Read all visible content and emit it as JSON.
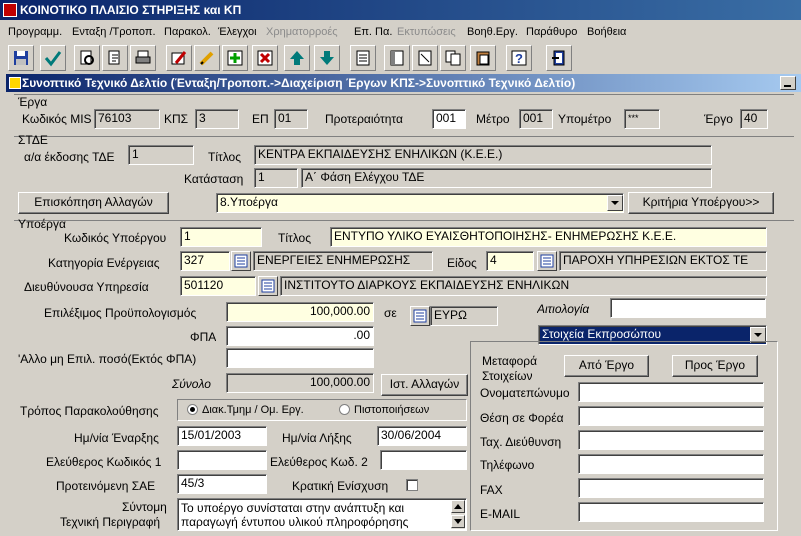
{
  "window": {
    "title": "ΚΟΙΝΟΤΙΚΟ ΠΛΑΙΣΙΟ ΣΤΗΡΙΞΗΣ και ΚΠ"
  },
  "menu": [
    {
      "label": "Προγραμμ."
    },
    {
      "label": "Ενταξη /Τροποπ."
    },
    {
      "label": "Παρακολ."
    },
    {
      "label": "Έλεγχοι"
    },
    {
      "label": "Χρηματορροές",
      "disabled": true
    },
    {
      "label": "Επ. Πα."
    },
    {
      "label": "Εκτυπώσεις",
      "disabled": true
    },
    {
      "label": "Βοηθ.Εργ."
    },
    {
      "label": "Παράθυρο"
    },
    {
      "label": "Βοήθεια"
    }
  ],
  "toolbar_icons": [
    "save-icon",
    "commit-icon",
    "query-icon",
    "execute-query-icon",
    "print-icon",
    "edit-icon",
    "insert-record-icon",
    "delete-record-icon",
    "previous-record-icon",
    "next-record-icon",
    "list-icon",
    "report-icon",
    "document-icon",
    "copy-icon",
    "paste-icon",
    "help-icon",
    "exit-icon"
  ],
  "child_window": {
    "title": "Συνοπτικό Τεχνικό Δελτίο (Ένταξη/Τροποπ.->Διαχείριση Έργων ΚΠΣ->Συνοπτικό Τεχνικό Δελτίο)"
  },
  "erga": {
    "section_label": "Έργα",
    "mis_label": "Κωδικός MIS",
    "mis_value": "76103",
    "kps_label": "ΚΠΣ",
    "kps_value": "3",
    "ep_label": "ΕΠ",
    "ep_value": "01",
    "priority_label": "Προτεραιότητα",
    "priority_value": "001",
    "measure_label": "Μέτρο",
    "measure_value": "001",
    "submeasure_label": "Υπομέτρο",
    "submeasure_value": "***",
    "project_label": "Έργο",
    "project_value": "40"
  },
  "tde": {
    "section_label": "ΣΤΔΕ",
    "issue_label": "α/α έκδοσης ΤΔΕ",
    "issue_value": "1",
    "title_label": "Τίτλος",
    "title_value": "ΚΕΝΤΡΑ ΕΚΠΑΙΔΕΥΣΗΣ ΕΝΗΛΙΚΩΝ (Κ.Ε.Ε.)",
    "status_label": "Κατάσταση",
    "status_code": "1",
    "status_text": "Α΄ Φάση Ελέγχου ΤΔΕ",
    "changes_button": "Επισκόπηση Αλλαγών",
    "view_select": "8.Υποέργα",
    "criteria_button": "Κριτήρια Υποέργου>>"
  },
  "subproject": {
    "section_label": "Υποέργα",
    "code_label": "Κωδικός Υποέργου",
    "code_value": "1",
    "title_label": "Τίτλος",
    "title_value": "ΕΝΤΥΠΟ ΥΛΙΚΟ ΕΥΑΙΣΘΗΤΟΠΟΙΗΣΗΣ- ΕΝΗΜΕΡΩΣΗΣ Κ.Ε.Ε.",
    "category_label": "Κατηγορία Ενέργειας",
    "category_code": "327",
    "category_text": "ΕΝΕΡΓΕΙΕΣ ΕΝΗΜΕΡΩΣΗΣ",
    "type_label": "Είδος",
    "type_code": "4",
    "type_text": "ΠΑΡΟΧΗ ΥΠΗΡΕΣΙΩΝ ΕΚΤΟΣ ΤΕ",
    "service_label": "Διευθύνουσα Υπηρεσία",
    "service_code": "501120",
    "service_text": "ΙΝΣΤΙΤΟΥΤΟ ΔΙΑΡΚΟΥΣ ΕΚΠΑΙΔΕΥΣΗΣ ΕΝΗΛΙΚΩΝ",
    "budget_label": "Επιλέξιμος Προϋπολογισμός",
    "budget_value": "100,000.00",
    "currency_label": "σε",
    "currency_value": "ΕΥΡΩ",
    "justification_label": "Αιτιολογία",
    "justification_value": "",
    "vat_label": "ΦΠΑ",
    "vat_value": ".00",
    "other_label": "'Αλλο μη Επιλ. ποσό(Εκτός ΦΠΑ)",
    "other_value": "",
    "total_label": "Σύνολο",
    "total_value": "100,000.00",
    "history_button": "Ιστ. Αλλαγών",
    "monitoring_label": "Τρόπος Παρακολούθησης",
    "monitoring_option1": "Διακ.Τμημ / Ομ. Εργ.",
    "monitoring_option2": "Πιστοποιήσεων",
    "start_label": "Ημ/νία Έναρξης",
    "start_value": "15/01/2003",
    "end_label": "Ημ/νία Λήξης",
    "end_value": "30/06/2004",
    "free_code1_label": "Ελεύθερος Κωδικός 1",
    "free_code1_value": "",
    "free_code2_label": "Ελεύθερος Κωδ. 2",
    "free_code2_value": "",
    "sae_label": "Προτεινόμενη ΣΑΕ",
    "sae_value": "45/3",
    "state_aid_label": "Κρατική Ενίσχυση",
    "desc_label_1": "Σύντομη",
    "desc_label_2": "Τεχνική Περιγραφή",
    "desc_value": "Το υποέργο συνίσταται στην ανάπτυξη και παραγωγή έντυπου υλικού πληροφόρησης"
  },
  "representative": {
    "dropdown": "Στοιχεία Εκπροσώπου",
    "transfer_label_1": "Μεταφορά",
    "transfer_label_2": "Στοιχείων",
    "from_button": "Από Έργο",
    "to_button": "Προς Έργο",
    "name_label": "Ονοματεπώνυμο",
    "name_value": "",
    "position_label": "Θέση σε Φορέα",
    "position_value": "",
    "address_label": "Ταχ. Διεύθυνση",
    "address_value": "",
    "phone_label": "Τηλέφωνο",
    "phone_value": "",
    "fax_label": "FAX",
    "fax_value": "",
    "email_label": "E-MAIL",
    "email_value": ""
  },
  "colors": {
    "title_bar": "#0a246a",
    "required_field": "#ffffe1",
    "selection": "#0a246a"
  }
}
